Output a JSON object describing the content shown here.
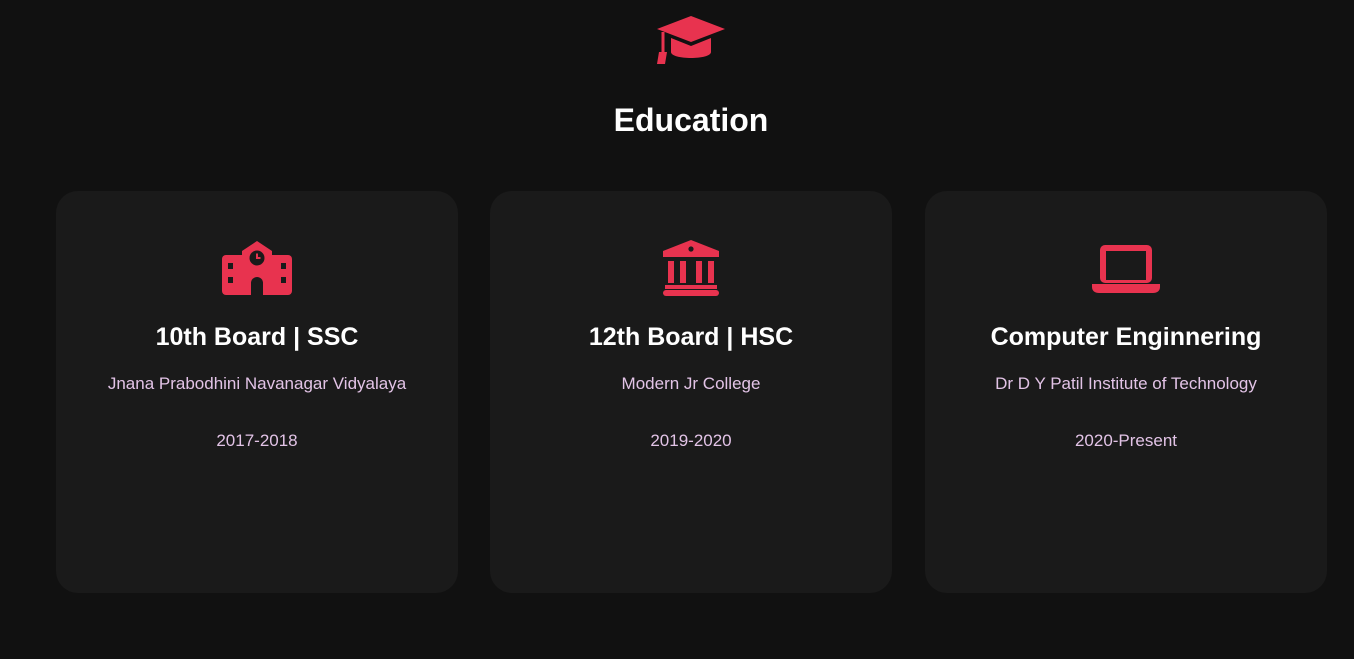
{
  "accent_color": "#e8334f",
  "section": {
    "icon": "graduation-cap-icon",
    "title": "Education"
  },
  "cards": [
    {
      "icon": "school-icon",
      "title": "10th Board | SSC",
      "school": "Jnana Prabodhini Navanagar Vidyalaya",
      "years": "2017-2018"
    },
    {
      "icon": "building-columns-icon",
      "title": "12th Board | HSC",
      "school": "Modern Jr College",
      "years": "2019-2020"
    },
    {
      "icon": "laptop-icon",
      "title": "Computer Enginnering",
      "school": "Dr D Y Patil Institute of Technology",
      "years": "2020-Present"
    }
  ]
}
